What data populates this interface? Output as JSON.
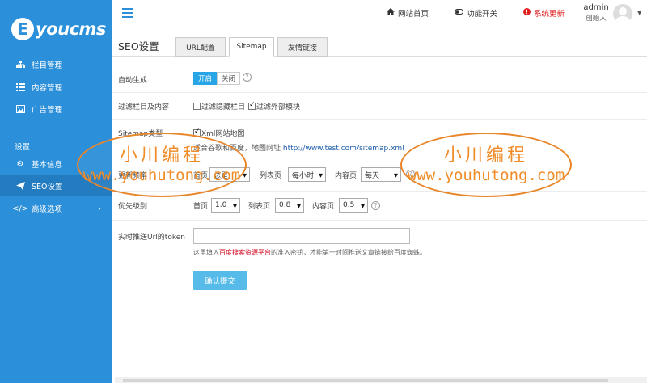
{
  "brand": {
    "logo_letter": "E",
    "logo_text": "youcms",
    "color": "#2c8fd9"
  },
  "sidebar": {
    "items": [
      {
        "label": "栏目管理",
        "icon": "sitemap-icon"
      },
      {
        "label": "内容管理",
        "icon": "list-icon"
      },
      {
        "label": "广告管理",
        "icon": "image-icon"
      }
    ],
    "section_label": "设置",
    "settings_items": [
      {
        "label": "基本信息",
        "icon": "gear-icon"
      },
      {
        "label": "SEO设置",
        "icon": "send-icon",
        "active": true
      },
      {
        "label": "高级选项",
        "icon": "code-icon",
        "has_arrow": true
      }
    ]
  },
  "topbar": {
    "home_label": "网站首页",
    "switch_label": "功能开关",
    "update_label": "系统更新",
    "user_name": "admin",
    "user_role": "创始人"
  },
  "page": {
    "title": "SEO设置",
    "tabs": [
      "URL配置",
      "Sitemap",
      "友情链接"
    ],
    "active_tab": "Sitemap"
  },
  "form": {
    "auto_generate": {
      "label": "自动生成",
      "on_label": "开启",
      "off_label": "关闭",
      "value": "开启"
    },
    "filter": {
      "label": "过滤栏目及内容",
      "option1": "过滤隐藏栏目",
      "option1_checked": false,
      "option2": "过滤外部模块",
      "option2_checked": true
    },
    "sitemap_type": {
      "label": "Sitemap类型",
      "option": "Xml网站地图",
      "option_checked": true,
      "hint_prefix": "适合谷歌和百度，地图网址",
      "url": "http://www.test.com/sitemap.xml"
    },
    "frequency": {
      "label": "更新频率",
      "home_label": "首页",
      "home_value": "总是",
      "list_label": "列表页",
      "list_value": "每小时",
      "content_label": "内容页",
      "content_value": "每天"
    },
    "priority": {
      "label": "优先级别",
      "home_label": "首页",
      "home_value": "1.0",
      "list_label": "列表页",
      "list_value": "0.8",
      "content_label": "内容页",
      "content_value": "0.5"
    },
    "token": {
      "label": "实时推送Url的token",
      "value": "",
      "hint_prefix": "这里填入",
      "hint_link": "百度搜索资源平台",
      "hint_suffix": "的准入密钥，才能第一时间推送文章链接给百度蜘蛛。"
    },
    "submit_label": "确认提交"
  },
  "watermark": {
    "cn": "小川编程",
    "en": "www.youhutong.com",
    "color": "#f08c28"
  }
}
